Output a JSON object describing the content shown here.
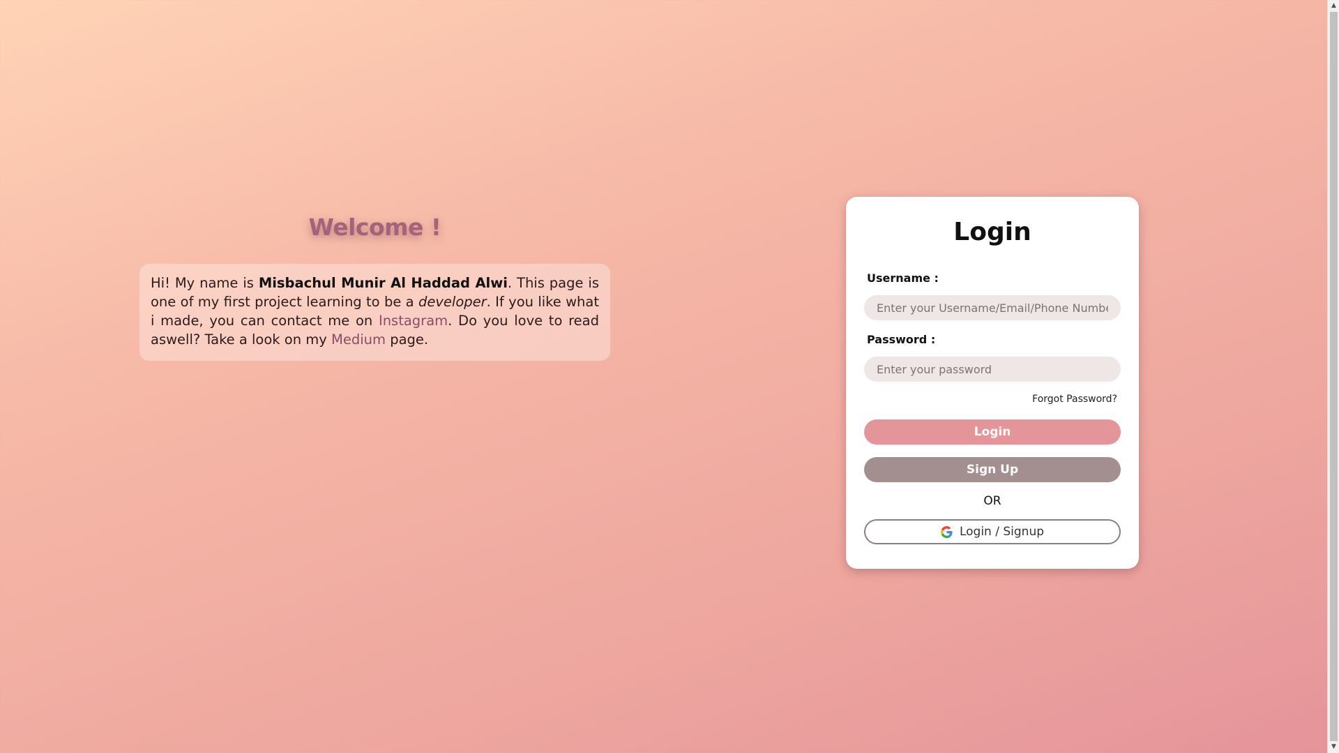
{
  "welcome": {
    "title": "Welcome !",
    "bio": {
      "part1": "Hi! My name is ",
      "name": "Misbachul Munir Al Haddad Alwi",
      "part2": ". This page is one of my first project learning to be a ",
      "role": "developer",
      "part3": ". If you like what i made, you can contact me on ",
      "instagram_link": "Instagram",
      "part4": ". Do you love to read aswell? Take a look on my ",
      "medium_link": "Medium",
      "part5": " page."
    }
  },
  "login": {
    "title": "Login",
    "username_label": "Username :",
    "username_placeholder": "Enter your Username/Email/Phone Number",
    "password_label": "Password :",
    "password_placeholder": "Enter your password",
    "forgot_label": "Forgot Password?",
    "login_button": "Login",
    "signup_button": "Sign Up",
    "or_text": "OR",
    "google_button": "Login / Signup",
    "google_icon": "google-icon"
  },
  "colors": {
    "login_button": "#e3959a",
    "signup_button": "#a38e90",
    "accent_link": "#8c4a66"
  }
}
